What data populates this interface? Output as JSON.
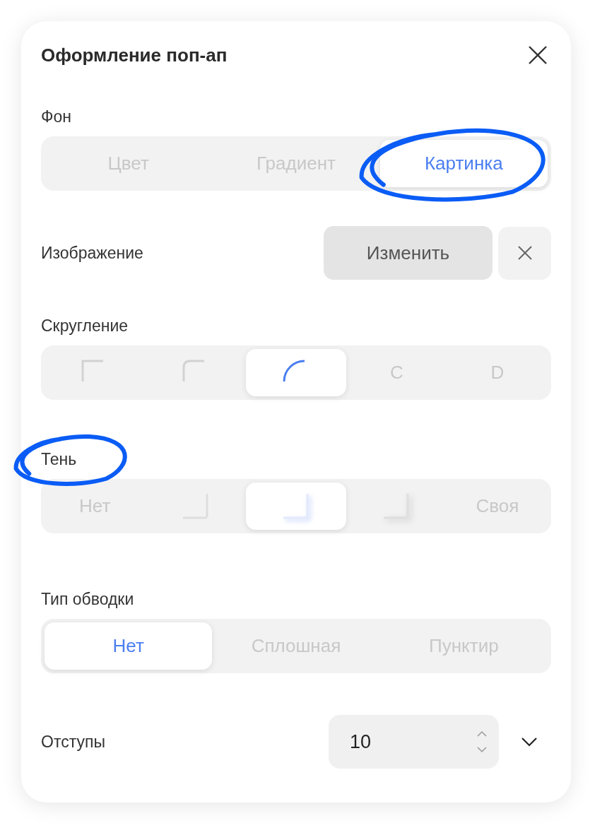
{
  "title": "Оформление поп-ап",
  "sections": [
    {
      "kind": "segmented",
      "label": "Фон",
      "options": [
        {
          "kind": "text",
          "text": "Цвет",
          "selected": false
        },
        {
          "kind": "text",
          "text": "Градиент",
          "selected": false
        },
        {
          "kind": "text",
          "text": "Картинка",
          "selected": true,
          "circled": true
        }
      ]
    },
    {
      "kind": "image",
      "label": "Изображение",
      "button": "Изменить"
    },
    {
      "kind": "segmented",
      "label": "Скругление",
      "options": [
        {
          "kind": "icon",
          "selected": false
        },
        {
          "kind": "icon",
          "selected": false
        },
        {
          "kind": "icon",
          "selected": true
        },
        {
          "kind": "text",
          "text": "C",
          "selected": false
        },
        {
          "kind": "text",
          "text": "D",
          "selected": false
        }
      ]
    },
    {
      "kind": "segmented",
      "label": "Тень",
      "label_circled": true,
      "options": [
        {
          "kind": "text",
          "text": "Нет",
          "selected": false
        },
        {
          "kind": "icon",
          "selected": false
        },
        {
          "kind": "icon",
          "selected": true
        },
        {
          "kind": "icon",
          "selected": false
        },
        {
          "kind": "text",
          "text": "Своя",
          "selected": false
        }
      ]
    },
    {
      "kind": "segmented",
      "label": "Тип обводки",
      "options": [
        {
          "kind": "text",
          "text": "Нет",
          "selected": true
        },
        {
          "kind": "text",
          "text": "Сплошная",
          "selected": false
        },
        {
          "kind": "text",
          "text": "Пунктир",
          "selected": false
        }
      ]
    },
    {
      "kind": "number",
      "label": "Отступы",
      "value": "10"
    }
  ]
}
